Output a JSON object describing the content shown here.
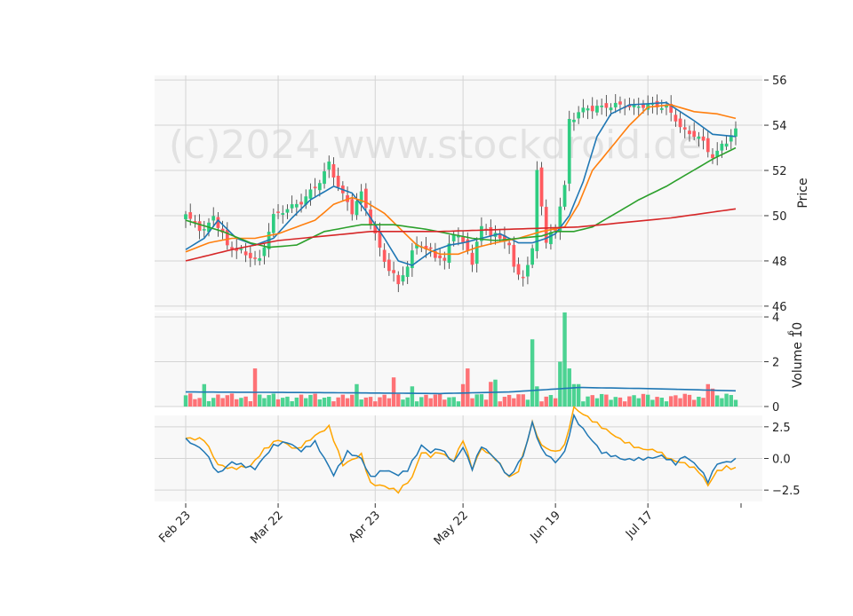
{
  "chart_data": {
    "type": "candlestick",
    "watermark": "(c)2024 www.stockdroid.de",
    "x_tick_labels": [
      "Feb 23",
      "Mar 22",
      "Apr 23",
      "May 22",
      "Jun 19",
      "Jul 17"
    ],
    "x_tick_index": [
      0,
      20,
      41,
      60,
      80,
      100
    ],
    "bar_count": 120,
    "price_panel": {
      "ylabel": "Price",
      "ylim": [
        45.8,
        56.2
      ],
      "yticks": [
        46,
        48,
        50,
        52,
        54,
        56
      ],
      "close_anchors": [
        [
          0,
          50.0
        ],
        [
          4,
          49.3
        ],
        [
          6,
          50.0
        ],
        [
          9,
          48.7
        ],
        [
          14,
          48.2
        ],
        [
          16,
          48.0
        ],
        [
          19,
          50.0
        ],
        [
          22,
          50.3
        ],
        [
          25,
          50.6
        ],
        [
          29,
          51.5
        ],
        [
          31,
          52.3
        ],
        [
          33,
          51.3
        ],
        [
          36,
          50.2
        ],
        [
          38,
          51.0
        ],
        [
          40,
          49.7
        ],
        [
          43,
          48.0
        ],
        [
          46,
          47.0
        ],
        [
          48,
          47.8
        ],
        [
          50,
          48.8
        ],
        [
          53,
          48.4
        ],
        [
          56,
          48.0
        ],
        [
          58,
          49.3
        ],
        [
          60,
          48.8
        ],
        [
          62,
          48.0
        ],
        [
          64,
          49.5
        ],
        [
          67,
          49.1
        ],
        [
          70,
          48.8
        ],
        [
          71,
          47.6
        ],
        [
          73,
          47.3
        ],
        [
          75,
          48.4
        ],
        [
          76,
          52.1
        ],
        [
          78,
          48.8
        ],
        [
          80,
          49.5
        ],
        [
          82,
          51.3
        ],
        [
          83,
          54.2
        ],
        [
          86,
          54.7
        ],
        [
          90,
          54.8
        ],
        [
          94,
          54.9
        ],
        [
          97,
          54.8
        ],
        [
          100,
          54.9
        ],
        [
          104,
          54.8
        ],
        [
          108,
          53.7
        ],
        [
          111,
          53.5
        ],
        [
          114,
          52.6
        ],
        [
          117,
          53.3
        ],
        [
          119,
          53.8
        ]
      ],
      "ma_lines": [
        {
          "color": "#1f77b4",
          "anchors": [
            [
              0,
              48.5
            ],
            [
              4,
              49.0
            ],
            [
              7,
              49.8
            ],
            [
              11,
              49.0
            ],
            [
              15,
              48.7
            ],
            [
              19,
              49.0
            ],
            [
              23,
              49.9
            ],
            [
              27,
              50.7
            ],
            [
              32,
              51.3
            ],
            [
              36,
              51.0
            ],
            [
              39,
              50.2
            ],
            [
              43,
              49.0
            ],
            [
              46,
              48.0
            ],
            [
              49,
              47.8
            ],
            [
              53,
              48.4
            ],
            [
              57,
              48.7
            ],
            [
              60,
              48.8
            ],
            [
              64,
              49.0
            ],
            [
              68,
              49.2
            ],
            [
              72,
              48.8
            ],
            [
              75,
              48.8
            ],
            [
              78,
              49.0
            ],
            [
              80,
              49.2
            ],
            [
              83,
              50.0
            ],
            [
              86,
              51.5
            ],
            [
              89,
              53.5
            ],
            [
              92,
              54.5
            ],
            [
              96,
              54.9
            ],
            [
              104,
              55.0
            ],
            [
              110,
              54.2
            ],
            [
              114,
              53.6
            ],
            [
              119,
              53.5
            ]
          ]
        },
        {
          "color": "#ff7f0e",
          "anchors": [
            [
              0,
              48.4
            ],
            [
              5,
              48.8
            ],
            [
              10,
              49.0
            ],
            [
              15,
              49.0
            ],
            [
              20,
              49.2
            ],
            [
              24,
              49.5
            ],
            [
              28,
              49.8
            ],
            [
              32,
              50.5
            ],
            [
              36,
              50.8
            ],
            [
              39,
              50.6
            ],
            [
              43,
              50.1
            ],
            [
              47,
              49.3
            ],
            [
              50,
              48.7
            ],
            [
              55,
              48.3
            ],
            [
              59,
              48.3
            ],
            [
              63,
              48.6
            ],
            [
              67,
              48.8
            ],
            [
              72,
              49.0
            ],
            [
              77,
              49.3
            ],
            [
              82,
              49.5
            ],
            [
              85,
              50.5
            ],
            [
              88,
              52.0
            ],
            [
              92,
              53.0
            ],
            [
              96,
              54.0
            ],
            [
              100,
              54.8
            ],
            [
              105,
              54.9
            ],
            [
              110,
              54.6
            ],
            [
              115,
              54.5
            ],
            [
              119,
              54.3
            ]
          ]
        },
        {
          "color": "#2ca02c",
          "anchors": [
            [
              0,
              49.8
            ],
            [
              8,
              49.3
            ],
            [
              14,
              48.8
            ],
            [
              18,
              48.6
            ],
            [
              24,
              48.7
            ],
            [
              30,
              49.3
            ],
            [
              38,
              49.6
            ],
            [
              45,
              49.6
            ],
            [
              52,
              49.4
            ],
            [
              57,
              49.2
            ],
            [
              62,
              49.0
            ],
            [
              67,
              48.9
            ],
            [
              72,
              49.0
            ],
            [
              77,
              49.1
            ],
            [
              80,
              49.3
            ],
            [
              84,
              49.3
            ],
            [
              88,
              49.5
            ],
            [
              93,
              50.1
            ],
            [
              98,
              50.7
            ],
            [
              104,
              51.3
            ],
            [
              109,
              51.9
            ],
            [
              114,
              52.5
            ],
            [
              119,
              53.0
            ]
          ]
        },
        {
          "color": "#d62728",
          "anchors": [
            [
              0,
              48.0
            ],
            [
              10,
              48.5
            ],
            [
              20,
              48.9
            ],
            [
              30,
              49.1
            ],
            [
              40,
              49.3
            ],
            [
              55,
              49.3
            ],
            [
              70,
              49.4
            ],
            [
              85,
              49.5
            ],
            [
              95,
              49.7
            ],
            [
              105,
              49.9
            ],
            [
              112,
              50.1
            ],
            [
              119,
              50.3
            ]
          ]
        }
      ]
    },
    "volume_panel": {
      "ylabel": "Volume  10",
      "ylabel_exponent": "6",
      "ylim": [
        0,
        4.2
      ],
      "yticks": [
        0,
        2,
        4
      ],
      "spikes": [
        [
          4,
          1.0
        ],
        [
          15,
          1.7
        ],
        [
          37,
          1.0
        ],
        [
          45,
          1.3
        ],
        [
          49,
          0.9
        ],
        [
          60,
          1.0
        ],
        [
          61,
          1.7
        ],
        [
          66,
          1.1
        ],
        [
          67,
          1.2
        ],
        [
          75,
          3.0
        ],
        [
          76,
          0.9
        ],
        [
          81,
          2.0
        ],
        [
          82,
          4.2
        ],
        [
          83,
          1.7
        ],
        [
          84,
          1.0
        ],
        [
          85,
          1.0
        ],
        [
          113,
          1.0
        ],
        [
          114,
          0.8
        ]
      ],
      "avg_anchors": [
        [
          0,
          0.65
        ],
        [
          30,
          0.62
        ],
        [
          55,
          0.58
        ],
        [
          70,
          0.65
        ],
        [
          80,
          0.78
        ],
        [
          85,
          0.85
        ],
        [
          100,
          0.8
        ],
        [
          110,
          0.75
        ],
        [
          119,
          0.7
        ]
      ],
      "up_color": "#2ecc80",
      "down_color": "#ff5a5f",
      "avg_color": "#1f77b4"
    },
    "oscillator_panel": {
      "ylim": [
        -3.4,
        3.4
      ],
      "yticks": [
        2.5,
        0.0,
        -2.5
      ],
      "ytick_labels": [
        "2.5",
        "0.0",
        "−2.5"
      ],
      "line1": {
        "color": "#1f77b4",
        "anchors": [
          [
            0,
            1.5
          ],
          [
            4,
            0.6
          ],
          [
            7,
            -1.2
          ],
          [
            10,
            -0.3
          ],
          [
            15,
            -0.8
          ],
          [
            19,
            1.0
          ],
          [
            22,
            1.3
          ],
          [
            25,
            0.6
          ],
          [
            28,
            1.3
          ],
          [
            32,
            -1.3
          ],
          [
            35,
            0.5
          ],
          [
            38,
            0.0
          ],
          [
            40,
            -1.5
          ],
          [
            43,
            -0.9
          ],
          [
            46,
            -1.3
          ],
          [
            48,
            -0.9
          ],
          [
            51,
            1.0
          ],
          [
            53,
            0.5
          ],
          [
            55,
            0.8
          ],
          [
            58,
            -0.3
          ],
          [
            60,
            0.9
          ],
          [
            62,
            -0.8
          ],
          [
            64,
            1.0
          ],
          [
            67,
            0.0
          ],
          [
            70,
            -1.5
          ],
          [
            73,
            0.2
          ],
          [
            75,
            2.8
          ],
          [
            77,
            0.7
          ],
          [
            80,
            -0.3
          ],
          [
            82,
            0.5
          ],
          [
            84,
            3.3
          ],
          [
            86,
            2.3
          ],
          [
            90,
            0.5
          ],
          [
            95,
            -0.1
          ],
          [
            100,
            0.0
          ],
          [
            103,
            0.2
          ],
          [
            106,
            -0.4
          ],
          [
            108,
            0.2
          ],
          [
            111,
            -0.7
          ],
          [
            113,
            -1.8
          ],
          [
            115,
            -0.4
          ],
          [
            117,
            -0.3
          ],
          [
            119,
            -0.1
          ]
        ]
      },
      "line2": {
        "color": "#ffa500",
        "anchors": [
          [
            0,
            1.6
          ],
          [
            4,
            1.5
          ],
          [
            7,
            -0.5
          ],
          [
            10,
            -0.8
          ],
          [
            14,
            -0.6
          ],
          [
            17,
            0.7
          ],
          [
            20,
            1.5
          ],
          [
            24,
            0.7
          ],
          [
            28,
            1.8
          ],
          [
            31,
            2.5
          ],
          [
            34,
            -0.5
          ],
          [
            38,
            0.3
          ],
          [
            40,
            -2.0
          ],
          [
            43,
            -2.2
          ],
          [
            46,
            -2.6
          ],
          [
            49,
            -1.5
          ],
          [
            51,
            0.5
          ],
          [
            53,
            0.2
          ],
          [
            55,
            0.5
          ],
          [
            58,
            -0.2
          ],
          [
            60,
            1.5
          ],
          [
            62,
            -0.8
          ],
          [
            64,
            0.8
          ],
          [
            67,
            0.0
          ],
          [
            70,
            -1.5
          ],
          [
            72,
            -1.0
          ],
          [
            75,
            2.8
          ],
          [
            77,
            1.0
          ],
          [
            80,
            0.5
          ],
          [
            82,
            1.0
          ],
          [
            84,
            4.0
          ],
          [
            86,
            3.5
          ],
          [
            90,
            2.5
          ],
          [
            94,
            1.5
          ],
          [
            98,
            0.8
          ],
          [
            102,
            0.6
          ],
          [
            105,
            -0.1
          ],
          [
            108,
            -0.4
          ],
          [
            111,
            -1.0
          ],
          [
            113,
            -2.1
          ],
          [
            115,
            -1.0
          ],
          [
            117,
            -0.7
          ],
          [
            119,
            -0.8
          ]
        ]
      }
    }
  }
}
